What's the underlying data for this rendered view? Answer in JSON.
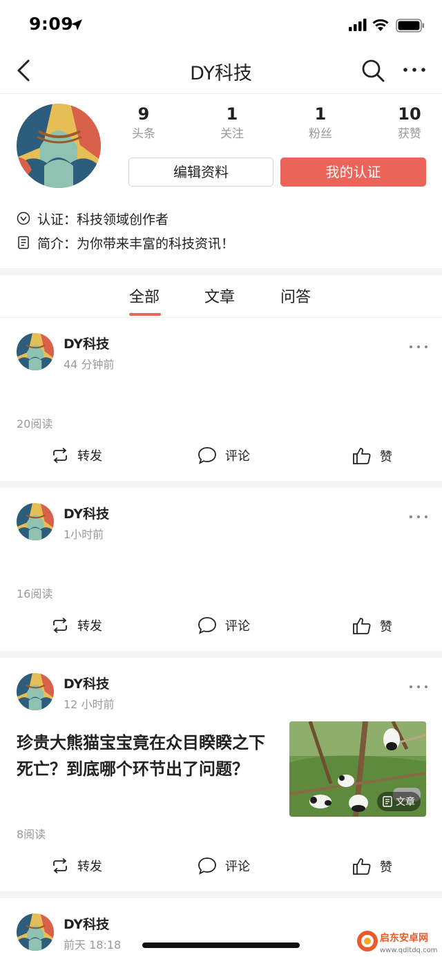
{
  "status_bar": {
    "time": "9:09"
  },
  "nav": {
    "title": "DY科技"
  },
  "profile": {
    "stats": [
      {
        "value": "9",
        "label": "头条"
      },
      {
        "value": "1",
        "label": "关注"
      },
      {
        "value": "1",
        "label": "粉丝"
      },
      {
        "value": "10",
        "label": "获赞"
      }
    ],
    "edit_button": "编辑资料",
    "cert_button": "我的认证",
    "certification": "认证：科技领域创作者",
    "intro": "简介：为你带来丰富的科技资讯！"
  },
  "tabs": [
    {
      "label": "全部",
      "active": true
    },
    {
      "label": "文章",
      "active": false
    },
    {
      "label": "问答",
      "active": false
    }
  ],
  "actions": {
    "repost": "转发",
    "comment": "评论",
    "like": "赞"
  },
  "posts": [
    {
      "author": "DY科技",
      "time": "44 分钟前",
      "reads": "20阅读"
    },
    {
      "author": "DY科技",
      "time": "1小时前",
      "reads": "16阅读"
    },
    {
      "author": "DY科技",
      "time": "12 小时前",
      "title": "珍贵大熊猫宝宝竟在众目睽睽之下死亡？到底哪个环节出了问题？",
      "reads": "8阅读",
      "thumb_badge": "文章"
    },
    {
      "author": "DY科技",
      "time": "前天 18:18"
    }
  ],
  "watermark": {
    "name": "启东安卓网",
    "url": "www.qdltdq.com"
  },
  "colors": {
    "accent": "#ea6459",
    "muted": "#999999",
    "divider": "#f4f4f4"
  }
}
